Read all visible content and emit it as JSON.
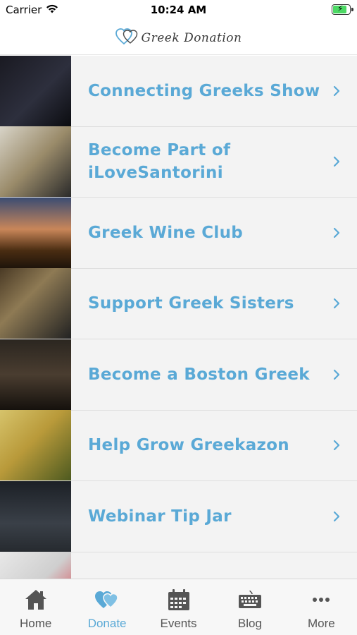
{
  "status_bar": {
    "carrier": "Carrier",
    "time": "10:24 AM"
  },
  "header": {
    "logo_text": "Greek Donation",
    "logo_icon": "heart-logo-icon",
    "accent": "#5aa9d6"
  },
  "items": [
    {
      "label": "Connecting Greeks Show",
      "thumb": "t1"
    },
    {
      "label": "Become Part of iLoveSantorini",
      "thumb": "t2"
    },
    {
      "label": "Greek Wine Club",
      "thumb": "t3"
    },
    {
      "label": "Support Greek Sisters",
      "thumb": "t4"
    },
    {
      "label": "Become a Boston Greek",
      "thumb": "t5"
    },
    {
      "label": "Help Grow Greekazon",
      "thumb": "t6"
    },
    {
      "label": "Webinar Tip Jar",
      "thumb": "t7"
    },
    {
      "label": "",
      "thumb": "t8"
    }
  ],
  "tabs": [
    {
      "label": "Home",
      "icon": "home-icon",
      "active": false
    },
    {
      "label": "Donate",
      "icon": "hearts-icon",
      "active": true
    },
    {
      "label": "Events",
      "icon": "calendar-icon",
      "active": false
    },
    {
      "label": "Blog",
      "icon": "keyboard-icon",
      "active": false
    },
    {
      "label": "More",
      "icon": "more-dots-icon",
      "active": false
    }
  ],
  "colors": {
    "accent": "#5aa9d6",
    "tab_inactive": "#555555",
    "list_bg": "#f3f3f3"
  }
}
